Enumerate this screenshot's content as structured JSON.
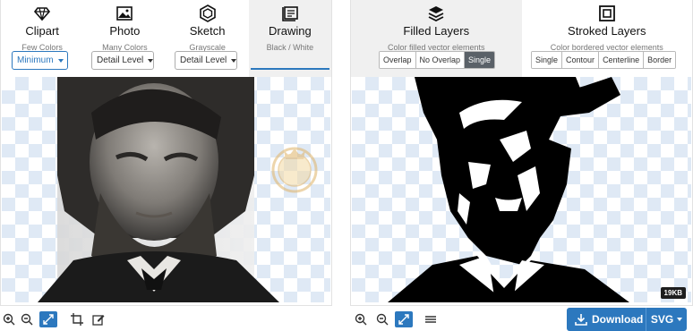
{
  "left_panel": {
    "tabs": [
      {
        "name": "Clipart",
        "subtitle": "Few Colors"
      },
      {
        "name": "Photo",
        "subtitle": "Many Colors"
      },
      {
        "name": "Sketch",
        "subtitle": "Grayscale"
      },
      {
        "name": "Drawing",
        "subtitle": "Black / White"
      }
    ],
    "dropdowns": {
      "clipart": "Minimum",
      "photo": "Detail Level",
      "sketch": "Detail Level"
    }
  },
  "right_panel": {
    "tabs": [
      {
        "name": "Filled Layers",
        "subtitle": "Color filled vector elements"
      },
      {
        "name": "Stroked Layers",
        "subtitle": "Color bordered vector elements"
      }
    ],
    "filled_options": [
      "Overlap",
      "No Overlap",
      "Single"
    ],
    "filled_selected": "Single",
    "stroked_options": [
      "Single",
      "Contour",
      "Centerline",
      "Border"
    ],
    "file_size": "19KB"
  },
  "download": {
    "label": "Download",
    "format": "SVG"
  },
  "colors": {
    "accent": "#2c78be",
    "selected_option_bg": "#5a6168",
    "checker": "#dfe9f5"
  },
  "icons": {
    "clipart": "diamond-gem-icon",
    "photo": "landscape-image-icon",
    "sketch": "hexagon-icon",
    "drawing": "drafting-board-icon",
    "filled": "stacked-layers-icon",
    "stroked": "framed-square-icon"
  }
}
